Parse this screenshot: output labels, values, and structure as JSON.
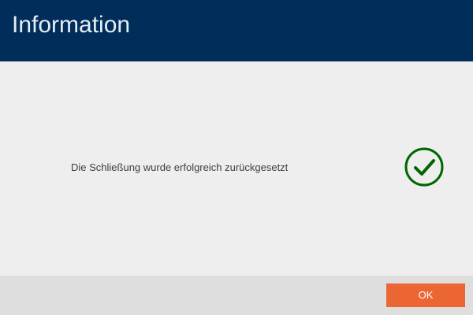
{
  "dialog": {
    "title": "Information",
    "message": "Die Schließung wurde erfolgreich zurückgesetzt",
    "icon": "check-circle-icon",
    "ok_label": "OK"
  },
  "colors": {
    "header_background": "#002d5a",
    "header_text": "#e7edf5",
    "content_background": "#eeeeee",
    "footer_background": "#dedede",
    "success_icon": "#006600",
    "button_background": "#ec6634",
    "button_text": "#ffffff"
  }
}
